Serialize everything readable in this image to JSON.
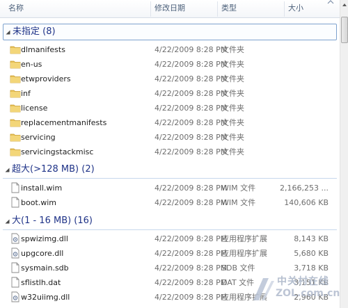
{
  "columns": {
    "name": "名称",
    "date": "修改日期",
    "type": "类型",
    "size": "大小"
  },
  "groups": [
    {
      "title": "未指定 (8)",
      "rows": [
        {
          "name": "dlmanifests",
          "date": "4/22/2009 8:28 PM",
          "type": "文件夹",
          "size": "",
          "icon": "folder-icon"
        },
        {
          "name": "en-us",
          "date": "4/22/2009 8:28 PM",
          "type": "文件夹",
          "size": "",
          "icon": "folder-icon"
        },
        {
          "name": "etwproviders",
          "date": "4/22/2009 8:28 PM",
          "type": "文件夹",
          "size": "",
          "icon": "folder-icon"
        },
        {
          "name": "inf",
          "date": "4/22/2009 8:28 PM",
          "type": "文件夹",
          "size": "",
          "icon": "folder-icon"
        },
        {
          "name": "license",
          "date": "4/22/2009 8:28 PM",
          "type": "文件夹",
          "size": "",
          "icon": "folder-icon"
        },
        {
          "name": "replacementmanifests",
          "date": "4/22/2009 8:28 PM",
          "type": "文件夹",
          "size": "",
          "icon": "folder-icon"
        },
        {
          "name": "servicing",
          "date": "4/22/2009 8:28 PM",
          "type": "文件夹",
          "size": "",
          "icon": "folder-icon"
        },
        {
          "name": "servicingstackmisc",
          "date": "4/22/2009 8:28 PM",
          "type": "文件夹",
          "size": "",
          "icon": "folder-icon"
        }
      ]
    },
    {
      "title": "超大(>128 MB) (2)",
      "rows": [
        {
          "name": "install.wim",
          "date": "4/22/2009 8:28 PM",
          "type": "WIM 文件",
          "size": "2,166,253 ...",
          "icon": "file-icon"
        },
        {
          "name": "boot.wim",
          "date": "4/22/2009 8:28 PM",
          "type": "WIM 文件",
          "size": "140,606 KB",
          "icon": "file-icon"
        }
      ]
    },
    {
      "title": "大(1 - 16 MB) (16)",
      "rows": [
        {
          "name": "spwizimg.dll",
          "date": "4/22/2009 8:28 PM",
          "type": "应用程序扩展",
          "size": "8,143 KB",
          "icon": "dll-file-icon"
        },
        {
          "name": "upgcore.dll",
          "date": "4/22/2009 8:28 PM",
          "type": "应用程序扩展",
          "size": "5,680 KB",
          "icon": "dll-file-icon"
        },
        {
          "name": "sysmain.sdb",
          "date": "4/22/2009 8:28 PM",
          "type": "SDB 文件",
          "size": "3,718 KB",
          "icon": "file-icon"
        },
        {
          "name": "sflistlh.dat",
          "date": "4/22/2009 8:28 PM",
          "type": "DAT 文件",
          "size": "3,151 KB",
          "icon": "file-icon"
        },
        {
          "name": "w32uiimg.dll",
          "date": "4/22/2009 8:28 PM",
          "type": "应用程序扩展",
          "size": "2,960 KB",
          "icon": "dll-file-icon"
        }
      ]
    }
  ],
  "watermark": {
    "cn": "中关村在线",
    "en": "ZOL.com.cn"
  },
  "colors": {
    "group_title": "#1e3287",
    "group_line": "#c7d7ec",
    "folder": "#e8c35a"
  }
}
